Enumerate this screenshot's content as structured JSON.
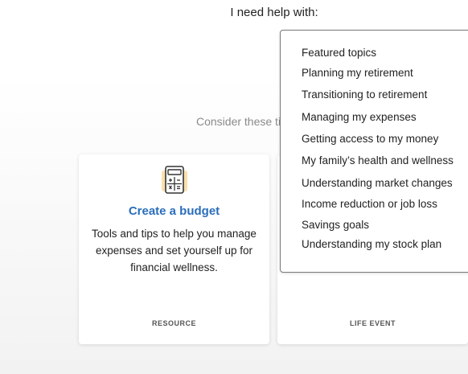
{
  "header": {
    "help_label": "I need help with:"
  },
  "section": {
    "subtitle": "Consider these tim"
  },
  "cards": [
    {
      "title": "Create a budget",
      "description": "Tools and tips to help you manage expenses and set yourself up for financial wellness.",
      "tag": "RESOURCE",
      "icon": "calculator-icon"
    },
    {
      "tag": "LIFE EVENT"
    }
  ],
  "dropdown": {
    "items": [
      "Featured topics",
      "Planning my retirement",
      "Transitioning to retirement",
      "Managing my expenses",
      "Getting access to my money",
      "My family’s health and wellness",
      "Understanding market changes",
      "Income reduction or job loss",
      "Savings goals",
      "Understanding my stock plan"
    ]
  },
  "colors": {
    "accent": "#2a6ebb",
    "icon_highlight": "#f5c76b"
  }
}
